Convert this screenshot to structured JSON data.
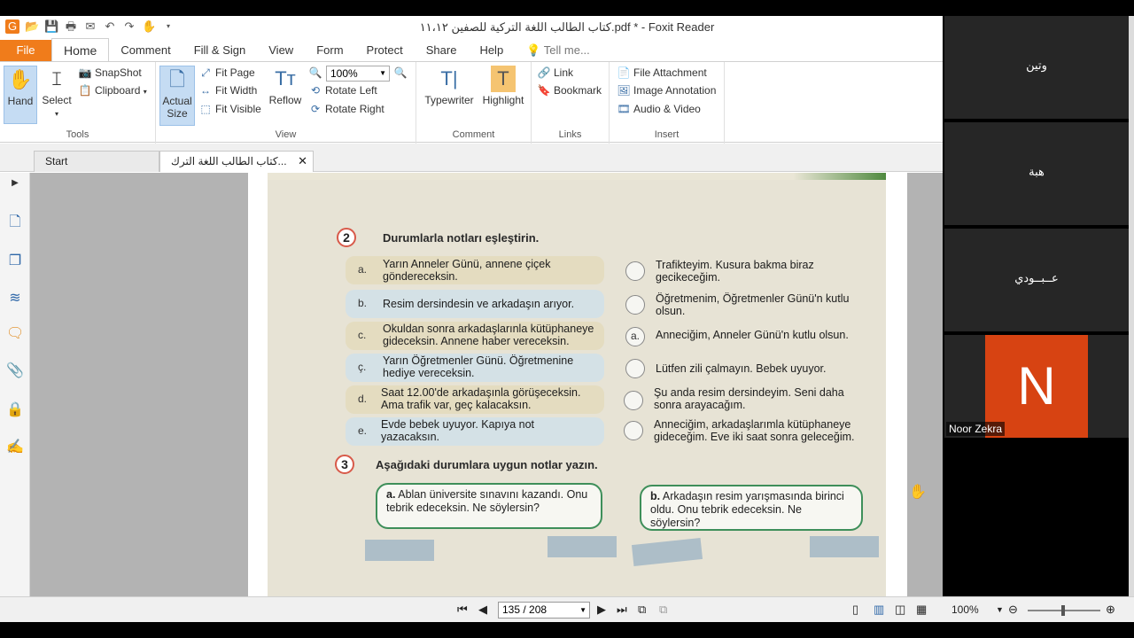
{
  "window": {
    "title": "كتاب الطالب اللغة التركية للصفين ١١،١٢.pdf * - Foxit Reader"
  },
  "ribbon_tabs": [
    "File",
    "Home",
    "Comment",
    "Fill & Sign",
    "View",
    "Form",
    "Protect",
    "Share",
    "Help"
  ],
  "tell_me": "Tell me...",
  "ribbon": {
    "tools": {
      "label": "Tools",
      "hand": "Hand",
      "select": "Select",
      "snapshot": "SnapShot",
      "clipboard": "Clipboard"
    },
    "view": {
      "label": "View",
      "actual_size": "Actual Size",
      "fit_page": "Fit Page",
      "fit_width": "Fit Width",
      "fit_visible": "Fit Visible",
      "reflow": "Reflow",
      "zoom_value": "100%",
      "rotate_left": "Rotate Left",
      "rotate_right": "Rotate Right"
    },
    "comment": {
      "label": "Comment",
      "typewriter": "Typewriter",
      "highlight": "Highlight"
    },
    "links": {
      "label": "Links",
      "link": "Link",
      "bookmark": "Bookmark"
    },
    "insert": {
      "label": "Insert",
      "file_attachment": "File Attachment",
      "image_annotation": "Image Annotation",
      "audio_video": "Audio & Video"
    }
  },
  "doc_tabs": {
    "start": "Start",
    "active": "كتاب الطالب اللغة الترك..."
  },
  "page_content": {
    "section2_no": "2",
    "section2_title": "Durumlarla notları eşleştirin.",
    "left_items": [
      {
        "letter": "a.",
        "text": "Yarın Anneler Günü, annene çiçek göndereceksin."
      },
      {
        "letter": "b.",
        "text": "Resim dersindesin ve arkadaşın arıyor."
      },
      {
        "letter": "c.",
        "text": "Okuldan sonra arkadaşlarınla kütüphaneye gideceksin. Annene haber vereceksin."
      },
      {
        "letter": "ç.",
        "text": "Yarın Öğretmenler Günü. Öğretmenine hediye vereceksin."
      },
      {
        "letter": "d.",
        "text": "Saat 12.00'de arkadaşınla görüşeceksin. Ama trafik var, geç kalacaksın."
      },
      {
        "letter": "e.",
        "text": "Evde bebek uyuyor. Kapıya not yazacaksın."
      }
    ],
    "right_items": [
      {
        "mark": "",
        "text": "Trafikteyim. Kusura bakma biraz gecikeceğim."
      },
      {
        "mark": "",
        "text": "Öğretmenim, Öğretmenler Günü'n kutlu olsun."
      },
      {
        "mark": "a.",
        "text": "Anneciğim, Anneler Günü'n kutlu olsun."
      },
      {
        "mark": "",
        "text": "Lütfen zili çalmayın. Bebek uyuyor."
      },
      {
        "mark": "",
        "text": "Şu anda resim dersindeyim. Seni daha sonra arayacağım."
      },
      {
        "mark": "",
        "text": "Anneciğim, arkadaşlarımla kütüphaneye gideceğim. Eve iki saat sonra geleceğim."
      }
    ],
    "section3_no": "3",
    "section3_title": "Aşağıdaki durumlara uygun notlar yazın.",
    "bubble_a_letter": "a.",
    "bubble_a": "Ablan üniversite sınavını kazandı. Onu tebrik edeceksin. Ne söylersin?",
    "bubble_b_letter": "b.",
    "bubble_b": "Arkadaşın resim yarışmasında birinci oldu. Onu tebrik edeceksin. Ne söylersin?"
  },
  "participants": [
    {
      "name": "وتين"
    },
    {
      "name": "هبة"
    },
    {
      "name": "عــبــودي"
    },
    {
      "name": "Noor Zekra",
      "initial": "N"
    }
  ],
  "statusbar": {
    "page": "135 / 208",
    "zoom": "100%"
  },
  "colors": {
    "file_tab": "#f07c1b",
    "avatar_bg": "#d74312"
  }
}
